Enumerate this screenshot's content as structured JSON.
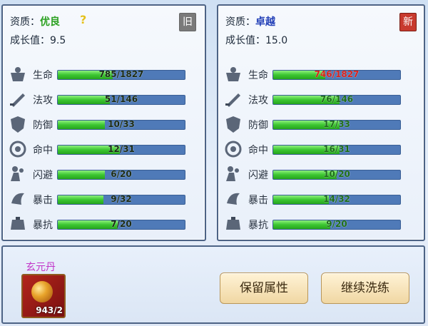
{
  "old": {
    "quality_label": "资质：",
    "quality": "优良",
    "help": "?",
    "growth_label": "成长值：",
    "growth": "9.5",
    "tag": "旧",
    "stats": [
      {
        "name": "生命",
        "value": "785/1827",
        "fill": 0.43,
        "icon": "life-icon"
      },
      {
        "name": "法攻",
        "value": "51/146",
        "fill": 0.41,
        "icon": "sword-icon"
      },
      {
        "name": "防御",
        "value": "10/33",
        "fill": 0.37,
        "icon": "shield-icon"
      },
      {
        "name": "命中",
        "value": "12/31",
        "fill": 0.49,
        "icon": "target-icon"
      },
      {
        "name": "闪避",
        "value": "6/20",
        "fill": 0.37,
        "icon": "dodge-icon"
      },
      {
        "name": "暴击",
        "value": "9/32",
        "fill": 0.36,
        "icon": "crit-icon"
      },
      {
        "name": "暴抗",
        "value": "7/20",
        "fill": 0.47,
        "icon": "armor-icon"
      }
    ]
  },
  "new": {
    "quality_label": "资质：",
    "quality": "卓越",
    "growth_label": "成长值：",
    "growth": "15.0",
    "tag": "新",
    "stats": [
      {
        "name": "生命",
        "value": "746/1827",
        "fill": 0.41,
        "icon": "life-icon",
        "color": "red"
      },
      {
        "name": "法攻",
        "value": "76/146",
        "fill": 0.52,
        "icon": "sword-icon",
        "color": "green"
      },
      {
        "name": "防御",
        "value": "17/33",
        "fill": 0.52,
        "icon": "shield-icon",
        "color": "green"
      },
      {
        "name": "命中",
        "value": "16/31",
        "fill": 0.52,
        "icon": "target-icon",
        "color": "green"
      },
      {
        "name": "闪避",
        "value": "10/20",
        "fill": 0.5,
        "icon": "dodge-icon",
        "color": "green"
      },
      {
        "name": "暴击",
        "value": "14/32",
        "fill": 0.44,
        "icon": "crit-icon",
        "color": "green"
      },
      {
        "name": "暴抗",
        "value": "9/20",
        "fill": 0.45,
        "icon": "armor-icon",
        "color": "green"
      }
    ]
  },
  "item": {
    "name": "玄元丹",
    "count": "943/2"
  },
  "buttons": {
    "keep": "保留属性",
    "continue": "继续洗练"
  }
}
